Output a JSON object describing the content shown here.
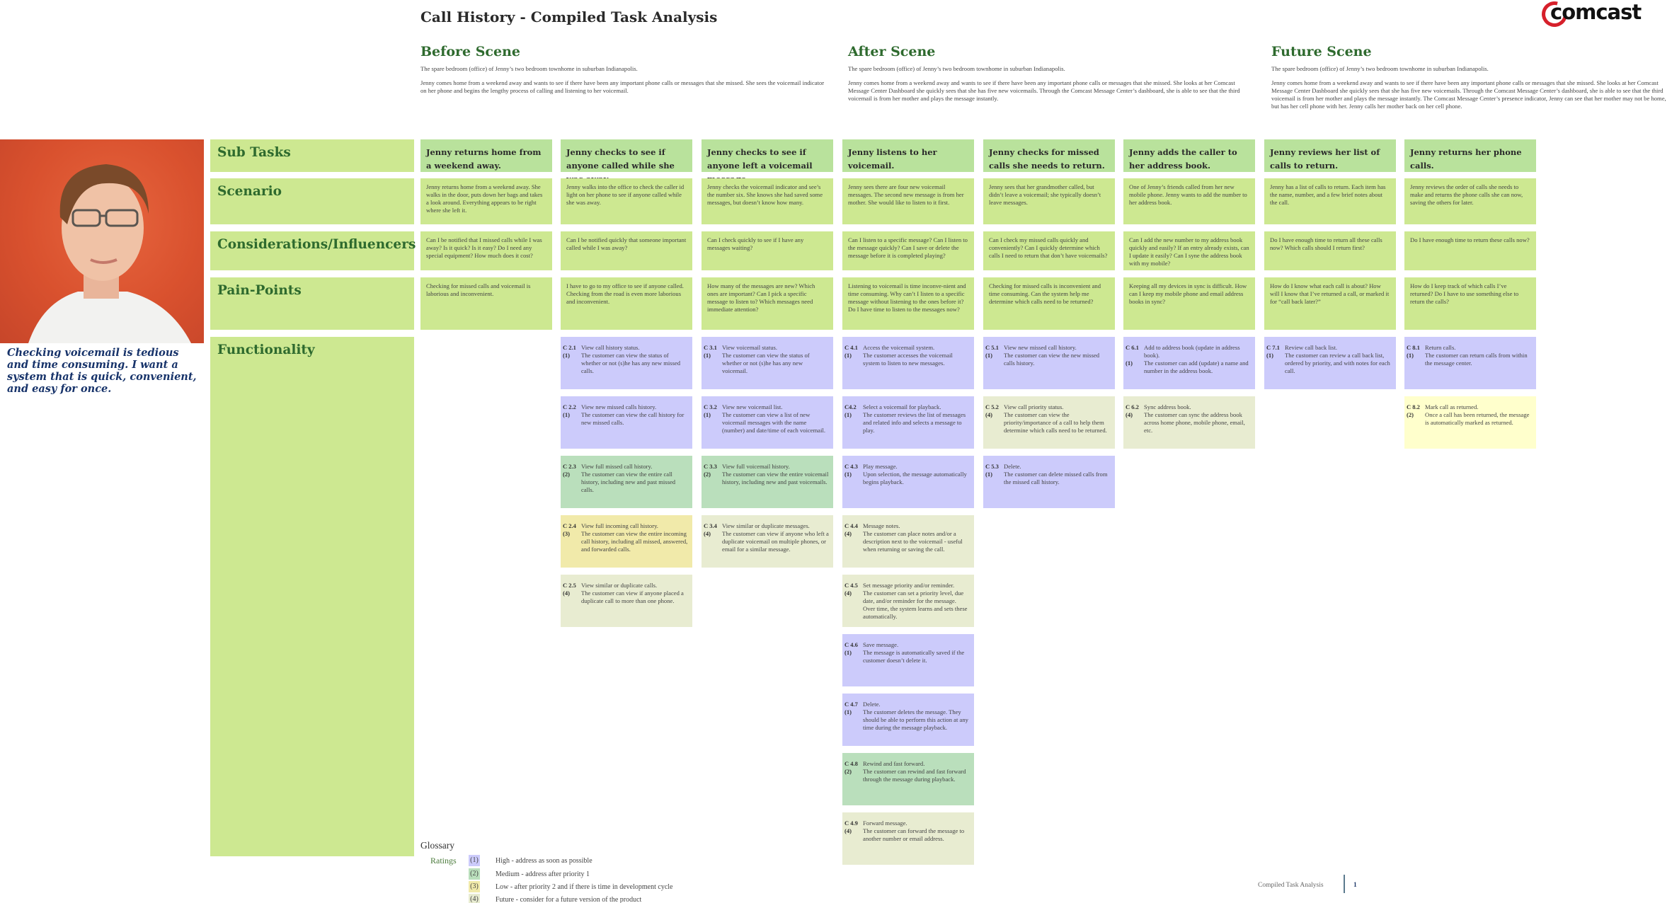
{
  "title": "Call History - Compiled Task Analysis",
  "logo": {
    "text": "comcast",
    "icon": "comcast-swoosh-logo"
  },
  "scenes": [
    {
      "heading": "Before Scene",
      "setting": "The spare bedroom (office) of Jenny’s two bedroom townhome in suburban Indianapolis.",
      "story": "Jenny comes home from a weekend away and wants to see if there have been any important phone calls or messages that she missed. She sees the voicemail indicator on her phone and begins the lengthy process of calling and listening to her voicemail."
    },
    {
      "heading": "After Scene",
      "setting": "The spare bedroom (office) of Jenny’s two bedroom townhome in suburban Indianapolis.",
      "story": "Jenny comes home from a weekend away and wants to see if there have been any important phone calls or messages that she missed. She looks at her Comcast Message Center Dashboard she quickly sees that she has five new voicemails. Through the Comcast Message Center’s dashboard, she is able to see that the third voicemail is from her mother and plays the message instantly."
    },
    {
      "heading": "Future Scene",
      "setting": "The spare bedroom (office) of Jenny’s two bedroom townhome in suburban Indianapolis.",
      "story": "Jenny comes home from a weekend away and wants to see if there have been any important phone calls or messages that she missed. She looks at her Comcast Message Center Dashboard she quickly sees that she has five new voicemails. Through the Comcast Message Center’s dashboard, she is able to see that the third voicemail is from her mother and plays the message instantly. The Comcast Message Center’s presence indicator, Jenny can see that her mother may not be home, but has her cell phone with her. Jenny calls her mother back on her cell phone."
    }
  ],
  "persona": {
    "photo": "persona-photo",
    "quote": "Checking voicemail is tedious and time consuming. I want a system that is quick, convenient, and easy for once."
  },
  "row_labels": {
    "subtasks": "Sub Tasks",
    "scenario": "Scenario",
    "considerations": "Considerations/Influencers",
    "painpoints": "Pain-Points",
    "functionality": "Functionality"
  },
  "columns": [
    {
      "subtask": "Jenny returns home from a weekend away.",
      "scenario": "Jenny returns home from a weekend away. She walks in the door, puts down her bags and takes a look around. Everything appears to be right where she left it.",
      "considerations": "Can I be notified that I missed calls while I was away? Is it quick? Is it easy? Do I need any special equipment? How much does it cost?",
      "painpoints": "Checking for missed calls and voicemail is laborious and inconvenient.",
      "functions": []
    },
    {
      "subtask": "Jenny checks to see if anyone called while she was away.",
      "scenario": "Jenny walks into the office to check the caller id light on her phone to see if anyone called while she was away.",
      "considerations": "Can I be notified quickly that someone important called while I was away?",
      "painpoints": "I have to go to my office to see if anyone called. Checking from the road is even more laborious and inconvenient.",
      "functions": [
        {
          "code": "C 2.1",
          "title": "View call history status.",
          "rating": "(1)",
          "desc": "The customer can view the status of whether or not (s)he has any new missed calls."
        },
        {
          "code": "C 2.2",
          "title": "View new missed calls history.",
          "rating": "(1)",
          "desc": "The customer can view the call history for new missed calls."
        },
        {
          "code": "C 2.3",
          "title": "View full missed call history.",
          "rating": "(2)",
          "desc": "The customer can view the entire call history, including new and past missed calls."
        },
        {
          "code": "C 2.4",
          "title": "View full incoming call history.",
          "rating": "(3)",
          "desc": "The customer can view the entire incoming call history, including all missed, answered, and forwarded calls."
        },
        {
          "code": "C 2.5",
          "title": "View similar or duplicate calls.",
          "rating": "(4)",
          "desc": "The customer can view if anyone placed a duplicate call to more than one phone."
        }
      ]
    },
    {
      "subtask": "Jenny checks to see if anyone left a voicemail message.",
      "scenario": "Jenny checks the voicemail indicator and see’s the number six. She knows she had saved some messages, but doesn’t know how many.",
      "considerations": "Can I check quickly to see if I have any messages waiting?",
      "painpoints": "How many of the messages are new? Which ones are important? Can I pick a specific message to listen to? Which messages need immediate attention?",
      "functions": [
        {
          "code": "C 3.1",
          "title": "View voicemail status.",
          "rating": "(1)",
          "desc": "The customer can view the status of whether or not (s)he has any new voicemail."
        },
        {
          "code": "C 3.2",
          "title": "View new voicemail list.",
          "rating": "(1)",
          "desc": "The customer can view a list of new voicemail messages with the name (number) and date/time of each voicemail."
        },
        {
          "code": "C 3.3",
          "title": "View full voicemail history.",
          "rating": "(2)",
          "desc": "The customer can view the entire voicemail history, including new and past voicemails."
        },
        {
          "code": "C 3.4",
          "title": "View similar or duplicate messages.",
          "rating": "(4)",
          "desc": "The customer can view if anyone who left a duplicate voicemail on multiple phones, or email for a similar message."
        }
      ]
    },
    {
      "subtask": "Jenny listens to her voicemail.",
      "scenario": "Jenny sees there are four new voicemail messages. The second new message is from her mother. She would like to listen to it first.",
      "considerations": "Can I listen to a specific message? Can I listen to the message quickly? Can I save or delete the message before it is completed playing?",
      "painpoints": "Listening to voicemail is time inconve-nient and time consuming. Why can’t I listen to a specific message without listening to the ones before it? Do I have time to listen to the messages now?",
      "functions": [
        {
          "code": "C 4.1",
          "title": "Access the voicemail system.",
          "rating": "(1)",
          "desc": "The customer accesses the voicemail system to listen to new messages."
        },
        {
          "code": "C4.2",
          "title": "Select a voicemail for playback.",
          "rating": "(1)",
          "desc": "The customer reviews the list of messages and related info and selects a message to play."
        },
        {
          "code": "C 4.3",
          "title": "Play message.",
          "rating": "(1)",
          "desc": "Upon selection, the message automatically begins playback."
        },
        {
          "code": "C 4.4",
          "title": "Message notes.",
          "rating": "(4)",
          "desc": "The customer can place notes and/or a description next to the voicemail - useful when returning or saving the call."
        },
        {
          "code": "C 4.5",
          "title": "Set message priority and/or reminder.",
          "rating": "(4)",
          "desc": "The customer can set a priority level, due date, and/or reminder for the message. Over time, the system learns and sets these automatically."
        },
        {
          "code": "C 4.6",
          "title": "Save message.",
          "rating": "(1)",
          "desc": "The message is automatically saved if the customer doesn’t delete it."
        },
        {
          "code": "C 4.7",
          "title": "Delete.",
          "rating": "(1)",
          "desc": "The customer deletes the message. They should be able to perform this action at any time during the message playback."
        },
        {
          "code": "C 4.8",
          "title": "Rewind and fast forward.",
          "rating": "(2)",
          "desc": "The customer can rewind  and fast forward through the message during playback."
        },
        {
          "code": "C 4.9",
          "title": "Forward message.",
          "rating": "(4)",
          "desc": "The customer can forward the message to another number or email address."
        }
      ]
    },
    {
      "subtask": "Jenny checks for missed calls she needs to return.",
      "scenario": "Jenny sees that her grandmother called, but didn’t leave a voicemail; she typically doesn’t leave messages.",
      "considerations": "Can I check my missed calls quickly and conveniently? Can I quickly determine which calls I need to return that don’t have voicemails?",
      "painpoints": "Checking for missed calls is inconvenient and time consuming. Can the system help me determine which calls need to be returned?",
      "functions": [
        {
          "code": "C 5.1",
          "title": "View new missed call history.",
          "rating": "(1)",
          "desc": "The customer can view the new missed calls history."
        },
        {
          "code": "C 5.2",
          "title": "View call priority status.",
          "rating": "(4)",
          "desc": "The customer can view the priority/importance of a call to help them determine which calls need to be returned."
        },
        {
          "code": "C 5.3",
          "title": "Delete.",
          "rating": "(1)",
          "desc": "The customer can delete missed calls from the missed call history."
        }
      ]
    },
    {
      "subtask": "Jenny adds the caller to her address book.",
      "scenario": "One of Jenny’s friends called from her new mobile phone. Jenny wants to add the number to her address book.",
      "considerations": "Can I add the new number to my address book quickly and easily? If an entry already exists, can I update it easily? Can I syne the address book with my mobile?",
      "painpoints": "Keeping all my devices in sync is difficult. How can I keep my mobile phone and email address books in sync?",
      "functions": [
        {
          "code": "C 6.1",
          "title": "Add to address book (update in address book).",
          "rating": "(1)",
          "desc": "The customer can add (update) a name and number in the address book."
        },
        {
          "code": "C 6.2",
          "title": "Sync address book.",
          "rating": "(4)",
          "desc": "The customer can sync the address book across home phone, mobile phone, email, etc."
        }
      ]
    },
    {
      "subtask": "Jenny reviews her list of calls to return.",
      "scenario": "Jenny has a list of calls to return. Each item has the name, number, and a few brief notes about the call.",
      "considerations": "Do I have enough time to return all these calls now? Which calls should I return first?",
      "painpoints": "How do I know what each call is about? How will I know that I’ve returned a call, or marked it for “call back later?”",
      "functions": [
        {
          "code": "C 7.1",
          "title": "Review call back list.",
          "rating": "(1)",
          "desc": "The customer can review a call back list, ordered by priority, and with notes for each call."
        }
      ]
    },
    {
      "subtask": "Jenny returns her phone calls.",
      "scenario": "Jenny reviews the order of calls she needs to make and returns the phone calls she can now, saving the others for later.",
      "considerations": "Do I have enough time to return these calls now?",
      "painpoints": "How do I keep track of which calls I’ve returned? Do I have to use something else to return the calls?",
      "functions": [
        {
          "code": "C 8.1",
          "title": "Return calls.",
          "rating": "(1)",
          "desc": "The customer can return calls from within the message center."
        },
        {
          "code": "C 8.2",
          "title": "Mark call as returned.",
          "rating": "(2)",
          "desc": "Once a call has been returned, the message is automatically marked as returned.",
          "style": "highlight"
        }
      ]
    }
  ],
  "glossary": {
    "title": "Glossary",
    "ratings_label": "Ratings",
    "items": [
      {
        "chip": "(1)",
        "text": "High - address as soon as possible",
        "color": "#cccbfb"
      },
      {
        "chip": "(2)",
        "text": "Medium -  address after priority 1",
        "color": "#badfbc"
      },
      {
        "chip": "(3)",
        "text": "Low - after priority 2 and if there is time in development cycle",
        "color": "#f1eaaa"
      },
      {
        "chip": "(4)",
        "text": "Future - consider for a future version of the product",
        "color": "#e8ecd1"
      }
    ]
  },
  "rating_colors": {
    "(1)": "#cccbfb",
    "(2)": "#badfbc",
    "(3)": "#f1eaaa",
    "(4)": "#e8ecd1",
    "highlight": "#ffffcc"
  },
  "footer": {
    "label": "Compiled Task Analysis",
    "page": "1"
  }
}
